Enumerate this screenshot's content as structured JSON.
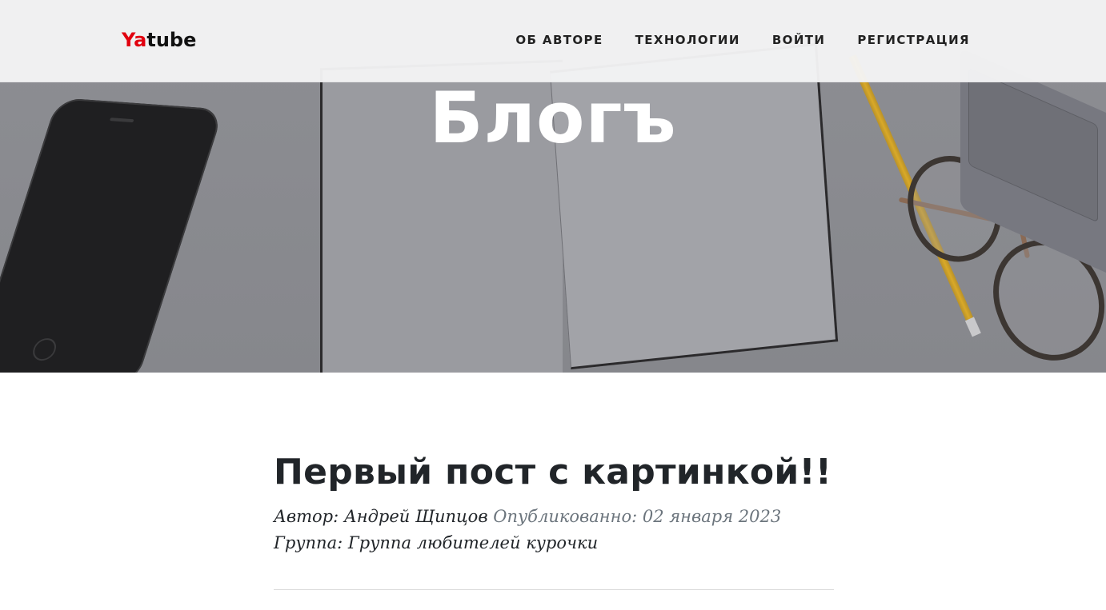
{
  "navbar": {
    "brand_prefix": "Ya",
    "brand_suffix": "tube",
    "links": [
      {
        "label": "ОБ АВТОРЕ"
      },
      {
        "label": "ТЕХНОЛОГИИ"
      },
      {
        "label": "ВОЙТИ"
      },
      {
        "label": "РЕГИСТРАЦИЯ"
      }
    ]
  },
  "hero": {
    "title": "Блогъ"
  },
  "post": {
    "title": "Первый пост с картинкой!!",
    "author_label": "Автор:",
    "author_name": "Андрей Щипцов",
    "published_label": "Опубликованно:",
    "published_date": "02 января 2023",
    "group_label": "Группа:",
    "group_name": "Группа любителей курочки"
  },
  "colors": {
    "brand_accent": "#e1000f",
    "text_dark": "#212529",
    "text_muted": "#6c757d"
  }
}
